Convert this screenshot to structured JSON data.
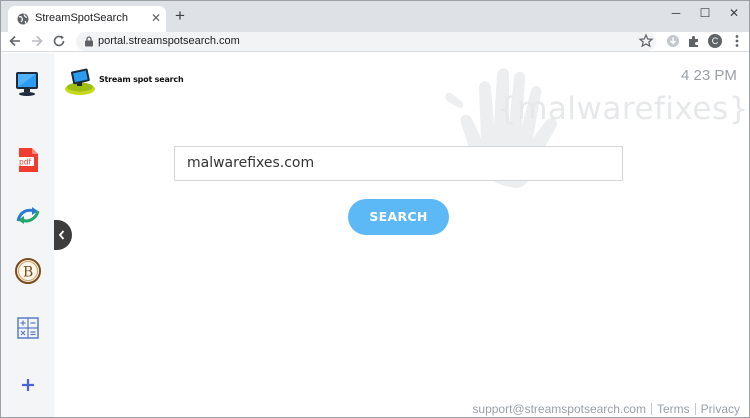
{
  "browser": {
    "tab_title": "StreamSpotSearch",
    "url": "portal.streamspotsearch.com",
    "profile_initial": "C"
  },
  "page": {
    "logo_text": "Stream spot search",
    "watermark": "{malwarefixes}",
    "clock": "4 23 PM",
    "search": {
      "value": "malwarefixes.com",
      "button_label": "SEARCH"
    },
    "sidebar": {
      "items": [
        {
          "icon": "tv-monitor-icon"
        },
        {
          "icon": "pdf-icon"
        },
        {
          "icon": "converter-arrows-icon"
        },
        {
          "icon": "bitcoin-icon"
        },
        {
          "icon": "calculator-icon"
        },
        {
          "icon": "plus-icon"
        }
      ]
    },
    "footer": {
      "support": "support@streamspotsearch.com",
      "terms": "Terms",
      "privacy": "Privacy"
    }
  },
  "colors": {
    "accent": "#5cb9f6",
    "sidebar_bg": "#f4f5f7",
    "tabstrip_bg": "#dee1e6"
  }
}
